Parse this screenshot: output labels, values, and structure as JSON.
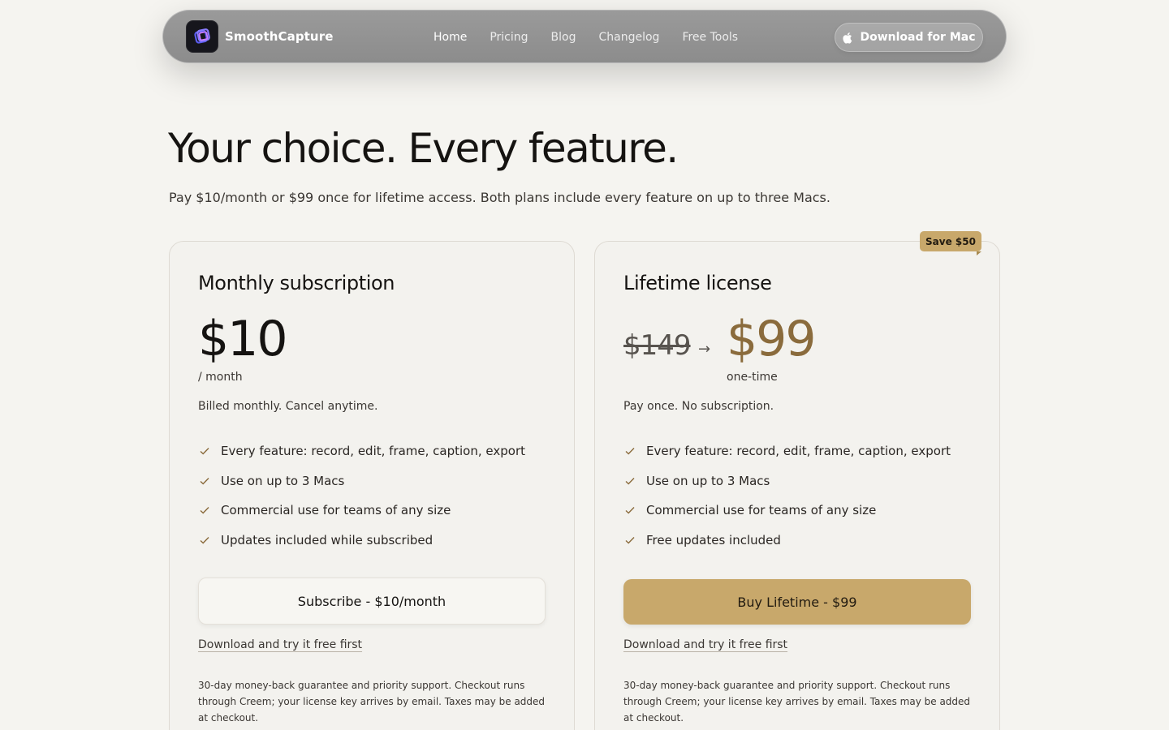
{
  "nav": {
    "brand": "SmoothCapture",
    "links": [
      "Home",
      "Pricing",
      "Blog",
      "Changelog",
      "Free Tools"
    ],
    "download_label": "Download for Mac"
  },
  "hero": {
    "title": "Your choice. Every feature.",
    "subtitle": "Pay $10/month or $99 once for lifetime access. Both plans include every feature on up to three Macs."
  },
  "monthly": {
    "title": "Monthly subscription",
    "price": "$10",
    "unit": "/ month",
    "billing": "Billed monthly. Cancel anytime.",
    "features": [
      "Every feature: record, edit, frame, caption, export",
      "Use on up to 3 Macs",
      "Commercial use for teams of any size",
      "Updates included while subscribed"
    ],
    "cta": "Subscribe - $10/month",
    "try_link": "Download and try it free first",
    "fine_print": "30-day money-back guarantee and priority support. Checkout runs through Creem; your license key arrives by email. Taxes may be added at checkout."
  },
  "lifetime": {
    "badge": "Save $50",
    "title": "Lifetime license",
    "old_price": "$149",
    "arrow": "→",
    "price": "$99",
    "unit": "one-time",
    "billing": "Pay once. No subscription.",
    "features": [
      "Every feature: record, edit, frame, caption, export",
      "Use on up to 3 Macs",
      "Commercial use for teams of any size",
      "Free updates included"
    ],
    "cta": "Buy Lifetime - $99",
    "try_link": "Download and try it free first",
    "fine_print": "30-day money-back guarantee and priority support. Checkout runs through Creem; your license key arrives by email. Taxes may be added at checkout."
  },
  "colors": {
    "page_bg": "#f5f4f0",
    "accent_gold": "#c8a86b",
    "price_gold": "#8a6b3c",
    "check": "#8a6b3c"
  }
}
